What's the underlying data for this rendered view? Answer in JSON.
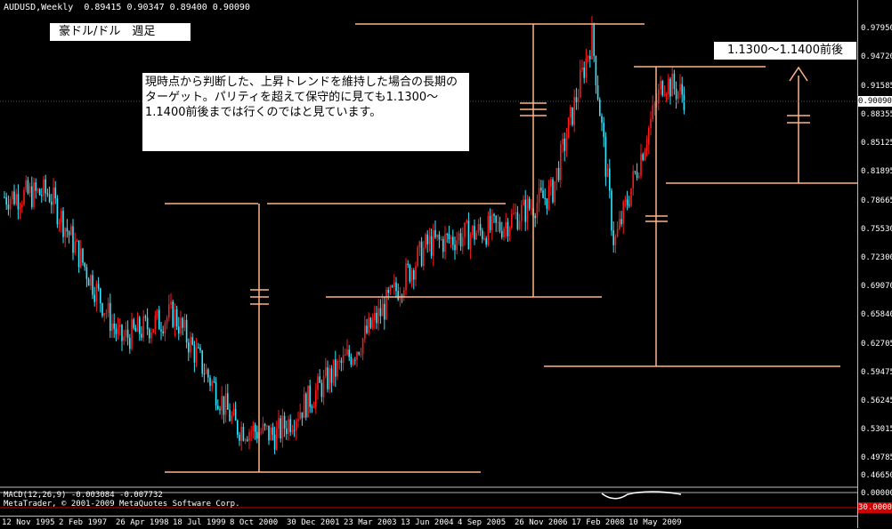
{
  "header": {
    "symbol": "AUDUSD,Weekly",
    "ohlc": "0.89415 0.90347 0.89400 0.90090"
  },
  "title_box": "豪ドル/ドル　週足",
  "target_label": "1.1300～1.1400前後",
  "comment": "現時点から判断した、上昇トレンドを維持した場合の長期のターゲット。パリティを超えて保守的に見ても1.1300～1.1400前後までは行くのではと見ています。",
  "price_axis": [
    "0.97950",
    "0.94720",
    "0.91585",
    "0.88355",
    "0.85125",
    "0.81895",
    "0.78665",
    "0.75530",
    "0.72300",
    "0.69070",
    "0.65840",
    "0.62705",
    "0.59475",
    "0.56245",
    "0.53015",
    "0.49785",
    "0.46650"
  ],
  "current_price": "0.90090",
  "macd_label": "MACD(12,26,9) -0.003084 -0.007732",
  "copyright": "MetaTrader, © 2001-2009 MetaQuotes Software Corp.",
  "time_axis": [
    "12 Nov 1995",
    "2 Feb 1997",
    "26 Apr 1998",
    "18 Jul 1999",
    "8 Oct 2000",
    "30 Dec 2001",
    "23 Mar 2003",
    "13 Jun 2004",
    "4 Sep 2005",
    "26 Nov 2006",
    "17 Feb 2008",
    "10 May 2009"
  ],
  "macd_axis_value": "0.00000",
  "red_tag": "30.0000",
  "colors": {
    "background": "#000000",
    "bull": "#ff1a1a",
    "bear": "#33e6ff",
    "annotation": "#ffb38a",
    "axis": "#bbbbbb"
  },
  "icons": [
    "up-arrow-icon"
  ],
  "chart_data": {
    "type": "candlestick",
    "ylim": [
      0.4665,
      0.9795
    ],
    "close_path": [
      [
        "12 Nov 1995",
        0.785
      ],
      [
        "2 Feb 1997",
        0.79
      ],
      [
        "26 Apr 1998",
        0.62
      ],
      [
        "18 Jul 1999",
        0.65
      ],
      [
        "8 Oct 2000",
        0.52
      ],
      [
        "30 Dec 2001",
        0.51
      ],
      [
        "23 Mar 2003",
        0.61
      ],
      [
        "13 Jun 2004",
        0.73
      ],
      [
        "4 Sep 2005",
        0.75
      ],
      [
        "26 Nov 2006",
        0.79
      ],
      [
        "17 Feb 2008",
        0.97
      ],
      [
        "10 May 2009",
        0.73
      ],
      [
        "10 May 2009",
        0.92
      ],
      [
        "10 May 2009",
        0.901
      ]
    ]
  }
}
